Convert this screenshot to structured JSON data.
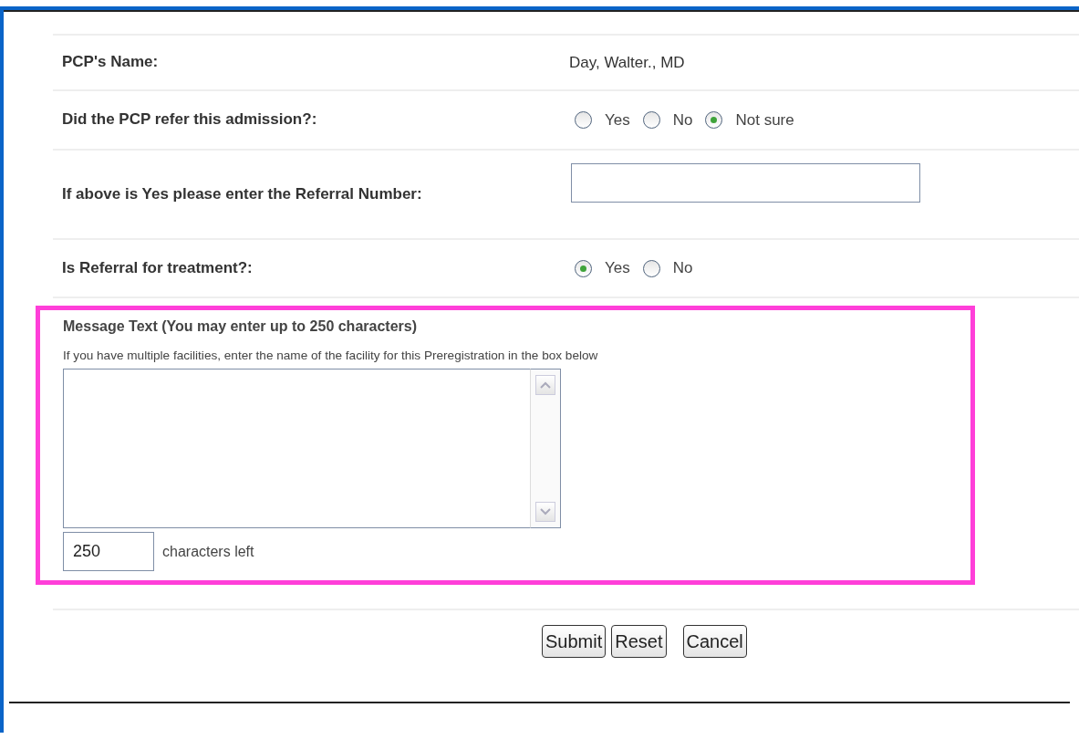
{
  "fields": [
    {
      "kind": "text",
      "label": "PCP's Name:",
      "value": "Day, Walter., MD"
    },
    {
      "kind": "radio",
      "label": "Did the PCP refer this admission?:",
      "options": [
        {
          "label": "Yes",
          "selected": false
        },
        {
          "label": "No",
          "selected": false
        },
        {
          "label": "Not sure",
          "selected": true
        }
      ]
    },
    {
      "kind": "input",
      "label": "If above is Yes please enter the Referral Number:"
    },
    {
      "kind": "radio",
      "label": "Is Referral for treatment?:",
      "options": [
        {
          "label": "Yes",
          "selected": true
        },
        {
          "label": "No",
          "selected": false
        }
      ]
    }
  ],
  "message": {
    "highlighted": true,
    "title": "Message Text (You may enter up to 250 characters)",
    "hint": "If you have multiple facilities, enter the name of the facility for this Preregistration in the box below",
    "counter": "250",
    "counter_label": "characters left"
  },
  "buttons": [
    "Submit",
    "Reset",
    "Cancel"
  ]
}
